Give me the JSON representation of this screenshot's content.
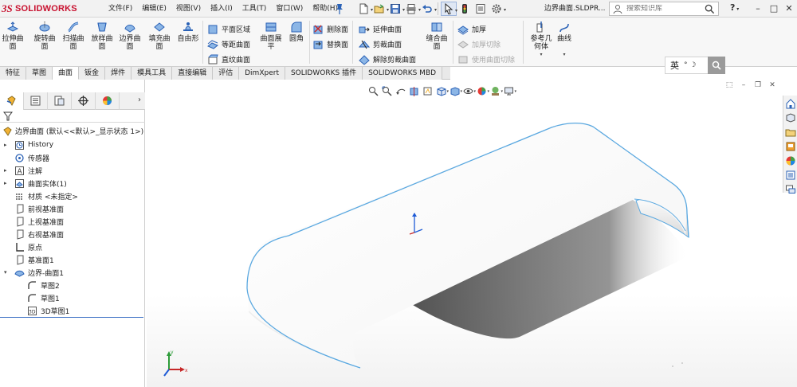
{
  "app": {
    "brand": "SOLIDWORKS",
    "logo_mark": "3S",
    "filename": "边界曲面.SLDPR...",
    "menu": [
      "文件(F)",
      "编辑(E)",
      "视图(V)",
      "插入(I)",
      "工具(T)",
      "窗口(W)",
      "帮助(H)"
    ],
    "search_placeholder": "搜索知识库",
    "help_label": "?",
    "window_buttons": [
      "–",
      "□",
      "✕"
    ]
  },
  "ribbon": {
    "big_buttons": [
      {
        "label": "拉伸曲面",
        "icon": "extruded-surface-icon"
      },
      {
        "label": "旋转曲面",
        "icon": "revolved-surface-icon"
      },
      {
        "label": "扫描曲面",
        "icon": "swept-surface-icon"
      },
      {
        "label": "放样曲面",
        "icon": "lofted-surface-icon"
      },
      {
        "label": "边界曲面",
        "icon": "boundary-surface-icon"
      },
      {
        "label": "填充曲面",
        "icon": "filled-surface-icon"
      },
      {
        "label": "自由形",
        "icon": "freeform-icon"
      },
      {
        "label": "曲面展平",
        "icon": "surface-flatten-icon"
      },
      {
        "label": "圆角",
        "icon": "fillet-icon"
      },
      {
        "label": "缝合曲面",
        "icon": "knit-surface-icon"
      },
      {
        "label": "参考几何体",
        "icon": "reference-geometry-icon"
      },
      {
        "label": "曲线",
        "icon": "curves-icon"
      }
    ],
    "small_buttons": [
      {
        "label": "平面区域",
        "icon": "planar-surface-icon",
        "disabled": false
      },
      {
        "label": "等距曲面",
        "icon": "offset-surface-icon",
        "disabled": false
      },
      {
        "label": "直纹曲面",
        "icon": "ruled-surface-icon",
        "disabled": false
      },
      {
        "label": "删除面",
        "icon": "delete-face-icon",
        "disabled": false
      },
      {
        "label": "替换面",
        "icon": "replace-face-icon",
        "disabled": false
      },
      {
        "label": "延伸曲面",
        "icon": "extend-surface-icon",
        "disabled": false
      },
      {
        "label": "剪裁曲面",
        "icon": "trim-surface-icon",
        "disabled": false
      },
      {
        "label": "解除剪裁曲面",
        "icon": "untrim-surface-icon",
        "disabled": false
      },
      {
        "label": "加厚",
        "icon": "thicken-icon",
        "disabled": false
      },
      {
        "label": "加厚切除",
        "icon": "thickened-cut-icon",
        "disabled": true
      },
      {
        "label": "使用曲面切除",
        "icon": "cut-with-surface-icon",
        "disabled": true
      }
    ]
  },
  "tabs": [
    "特征",
    "草图",
    "曲面",
    "钣金",
    "焊件",
    "模具工具",
    "直接编辑",
    "评估",
    "DimXpert",
    "SOLIDWORKS 插件",
    "SOLIDWORKS MBD"
  ],
  "active_tab": "曲面",
  "ime": {
    "label": "英",
    "dots": "° ☽"
  },
  "tree": {
    "root": "边界曲面 (默认<<默认>_显示状态 1>)",
    "items": [
      {
        "label": "History",
        "icon": "history-icon",
        "expandable": true
      },
      {
        "label": "传感器",
        "icon": "sensor-icon",
        "expandable": false
      },
      {
        "label": "注解",
        "icon": "annotation-icon",
        "expandable": true
      },
      {
        "label": "曲面实体(1)",
        "icon": "surface-bodies-icon",
        "expandable": true
      },
      {
        "label": "材质 <未指定>",
        "icon": "material-icon",
        "expandable": false
      },
      {
        "label": "前视基准面",
        "icon": "plane-icon",
        "expandable": false
      },
      {
        "label": "上视基准面",
        "icon": "plane-icon",
        "expandable": false
      },
      {
        "label": "右视基准面",
        "icon": "plane-icon",
        "expandable": false
      },
      {
        "label": "原点",
        "icon": "origin-icon",
        "expandable": false
      },
      {
        "label": "基准面1",
        "icon": "plane-icon",
        "expandable": false
      },
      {
        "label": "边界-曲面1",
        "icon": "boundary-surface-icon",
        "expandable": true,
        "expanded": true
      },
      {
        "label": "草图2",
        "icon": "sketch-icon",
        "child": true
      },
      {
        "label": "草图1",
        "icon": "sketch-icon",
        "child": true
      },
      {
        "label": "3D草图1",
        "icon": "3d-sketch-icon",
        "child": true
      }
    ]
  },
  "colors": {
    "accent": "#3a6fc4",
    "brand": "#c8102e",
    "model_edge": "#5aa8e0"
  }
}
